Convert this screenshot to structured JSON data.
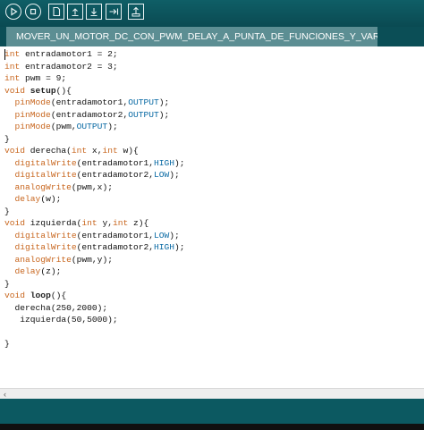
{
  "toolbar": {
    "buttons": [
      {
        "name": "verify",
        "icon": "play-icon"
      },
      {
        "name": "stop",
        "icon": "stop-icon"
      },
      {
        "name": "new",
        "icon": "new-file-icon"
      },
      {
        "name": "open",
        "icon": "open-upload-icon"
      },
      {
        "name": "save",
        "icon": "save-download-icon"
      },
      {
        "name": "upload",
        "icon": "upload-arrow-icon"
      },
      {
        "name": "serial-monitor",
        "icon": "serial-monitor-icon"
      }
    ]
  },
  "tab": {
    "title": "MOVER_UN_MOTOR_DC_CON_PWM_DELAY_A_PUNTA_DE_FUNCIONES_Y_VARIABLE"
  },
  "code": {
    "lines": [
      "int entradamotor1 = 2;",
      "int entradamotor2 = 3;",
      "int pwm = 9;",
      "void setup(){",
      "  pinMode(entradamotor1,OUTPUT);",
      "  pinMode(entradamotor2,OUTPUT);",
      "  pinMode(pwm,OUTPUT);",
      "}",
      "void derecha(int x,int w){",
      "  digitalWrite(entradamotor1,HIGH);",
      "  digitalWrite(entradamotor2,LOW);",
      "  analogWrite(pwm,x);",
      "  delay(w);",
      "}",
      "void izquierda(int y,int z){",
      "  digitalWrite(entradamotor1,LOW);",
      "  digitalWrite(entradamotor2,HIGH);",
      "  analogWrite(pwm,y);",
      "  delay(z);",
      "}",
      "void loop(){",
      "  derecha(250,2000);",
      "   izquierda(50,5000);",
      "",
      "}"
    ]
  },
  "scrollbar": {
    "left_arrow": "‹"
  },
  "colors": {
    "toolbar": "#0f5e66",
    "tab_active": "#5c8e93",
    "keyword": "#c8661e",
    "constant": "#0a6aa4"
  }
}
